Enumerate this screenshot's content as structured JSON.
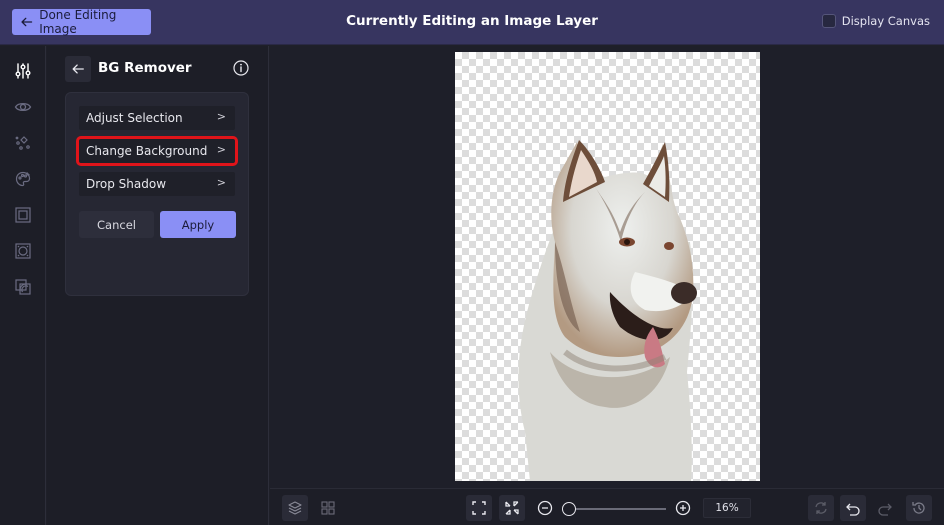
{
  "topbar": {
    "done_label": "Done Editing Image",
    "title": "Currently Editing an Image Layer",
    "display_canvas_label": "Display Canvas",
    "display_canvas_checked": false
  },
  "iconbar": {
    "items": [
      {
        "icon": "adjustments-icon",
        "active": true
      },
      {
        "icon": "eye-icon",
        "active": false
      },
      {
        "icon": "sparkles-icon",
        "active": false
      },
      {
        "icon": "palette-icon",
        "active": false
      },
      {
        "icon": "frame-icon",
        "active": false
      },
      {
        "icon": "texture-frame-icon",
        "active": false
      },
      {
        "icon": "overlay-icon",
        "active": false
      }
    ]
  },
  "panel": {
    "title": "BG Remover",
    "menu": [
      {
        "label": "Adjust Selection",
        "highlighted": false
      },
      {
        "label": "Change Background",
        "highlighted": true
      },
      {
        "label": "Drop Shadow",
        "highlighted": false
      }
    ],
    "chevron": ">",
    "cancel_label": "Cancel",
    "apply_label": "Apply"
  },
  "canvas": {
    "image_description": "Siberian husky with background removed on transparent checkerboard"
  },
  "bottombar": {
    "zoom_value": "16%",
    "zoom_slider_fraction": 0.0
  },
  "colors": {
    "accent": "#8a8ff5",
    "topbar": "#373560",
    "highlight_border": "#e0141a"
  }
}
